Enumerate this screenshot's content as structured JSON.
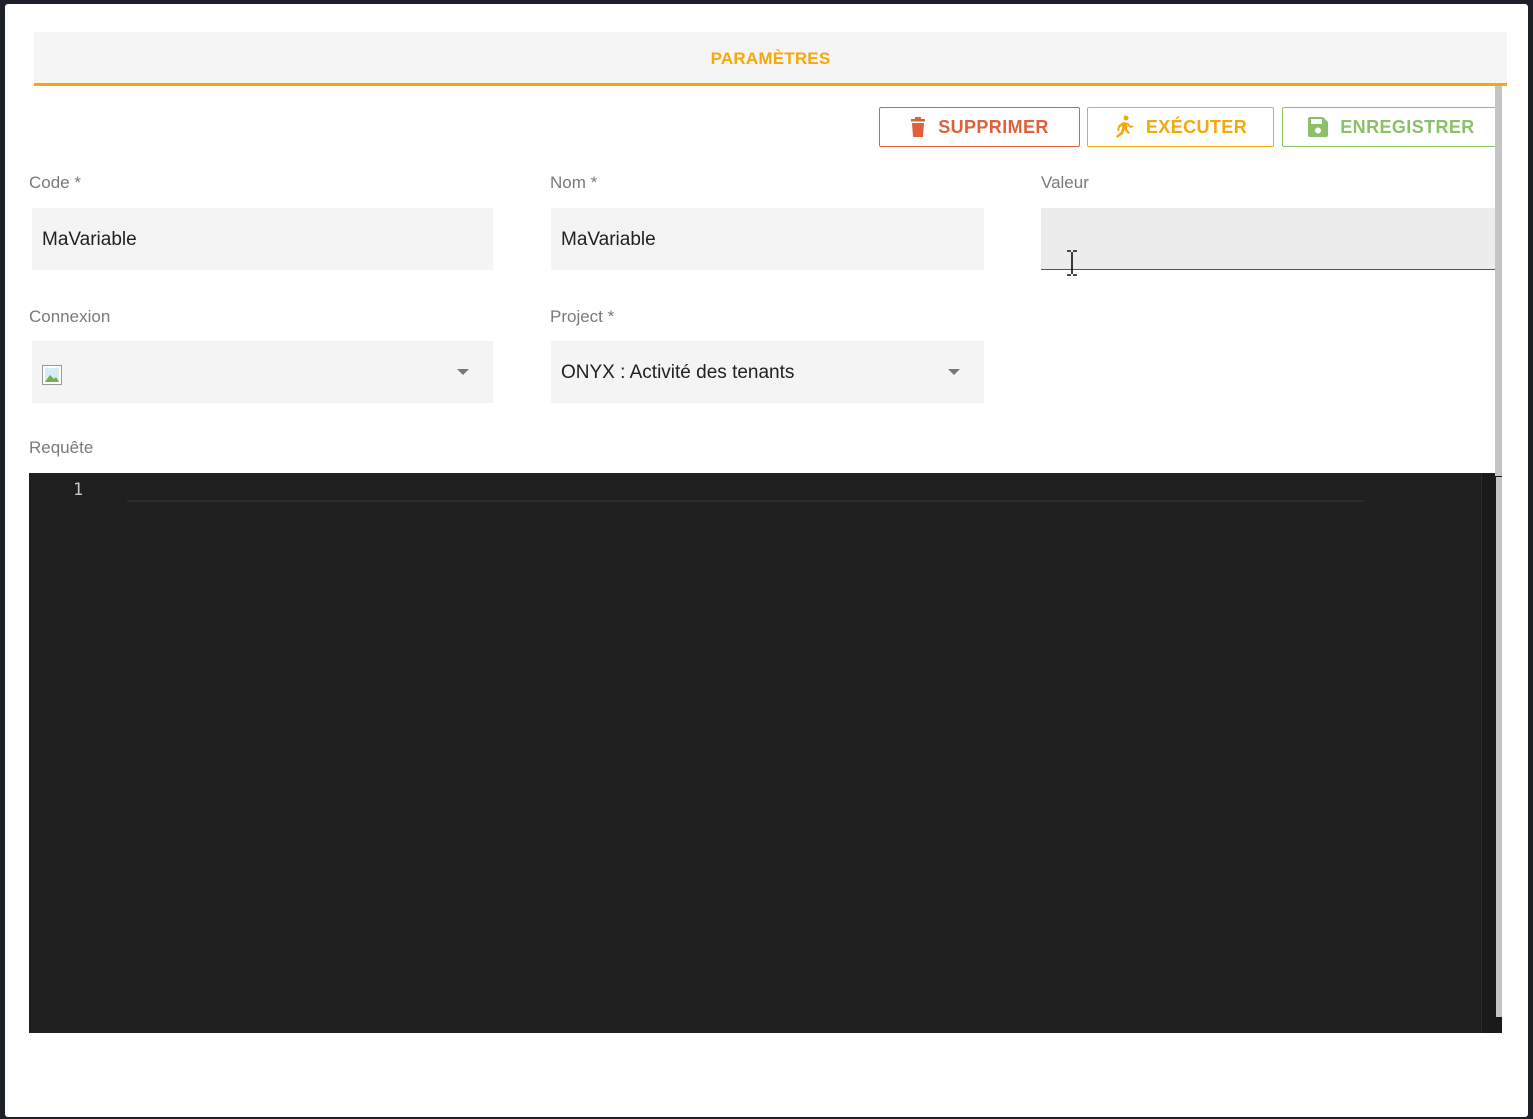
{
  "tab": {
    "label": "PARAMÈTRES"
  },
  "toolbar": {
    "delete_label": "SUPPRIMER",
    "run_label": "EXÉCUTER",
    "save_label": "ENREGISTRER",
    "delete_icon": "trash-icon",
    "run_icon": "runner-icon",
    "save_icon": "floppy-disk-icon"
  },
  "form": {
    "code": {
      "label": "Code *",
      "value": "MaVariable"
    },
    "nom": {
      "label": "Nom *",
      "value": "MaVariable"
    },
    "valeur": {
      "label": "Valeur",
      "value": ""
    },
    "connexion": {
      "label": "Connexion",
      "value": ""
    },
    "project": {
      "label": "Project *",
      "value": "ONYX : Activité des tenants"
    },
    "requete": {
      "label": "Requête"
    }
  },
  "editor": {
    "line_numbers": [
      "1"
    ],
    "content": ""
  },
  "colors": {
    "accent": "#f5a80a",
    "danger": "#e0603a",
    "success": "#8cc068",
    "editor_bg": "#1f1f1f"
  }
}
